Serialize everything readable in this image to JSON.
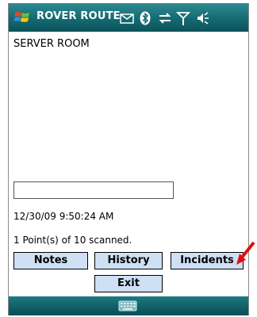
{
  "titlebar": {
    "title": "ROVER ROUTE",
    "icons": [
      "windows-start-icon",
      "mail-icon",
      "bluetooth-icon",
      "data-connection-icon",
      "signal-strength-icon",
      "volume-icon"
    ]
  },
  "content": {
    "location": "SERVER ROOM",
    "input_value": "",
    "timestamp": "12/30/09 9:50:24 AM",
    "scan_status": "1 Point(s) of 10 scanned."
  },
  "buttons": {
    "notes": "Notes",
    "history": "History",
    "incidents": "Incidents",
    "exit": "Exit"
  },
  "bottombar": {
    "icon": "keyboard-icon"
  },
  "colors": {
    "titlebar": "#156a72",
    "button_face": "#cfe0f5",
    "annotation_arrow": "#e01010"
  }
}
